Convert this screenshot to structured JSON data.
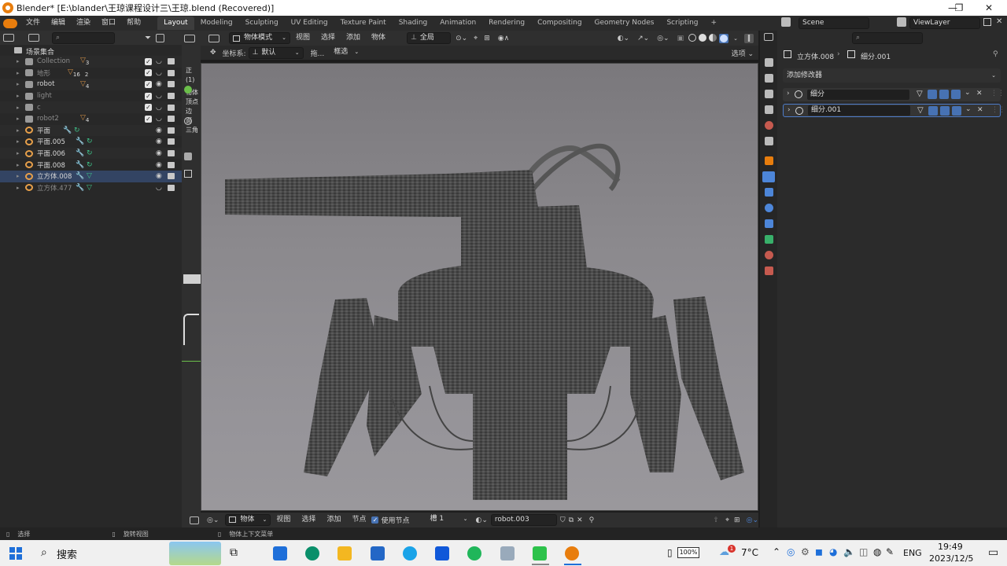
{
  "window": {
    "title": "Blender* [E:\\blander\\王琼课程设计三\\王琼.blend (Recovered)]",
    "minimize": "—",
    "maximize": "❐",
    "close": "✕"
  },
  "topbar": {
    "menus": [
      "文件",
      "编辑",
      "渲染",
      "窗口",
      "帮助"
    ],
    "workspaces": [
      "Layout",
      "Modeling",
      "Sculpting",
      "UV Editing",
      "Texture Paint",
      "Shading",
      "Animation",
      "Rendering",
      "Compositing",
      "Geometry Nodes",
      "Scripting"
    ],
    "active_workspace": "Layout",
    "add_tab": "+",
    "scene_label": "Scene",
    "viewlayer_label": "ViewLayer"
  },
  "outliner": {
    "root_label": "场景集合",
    "rows": [
      {
        "label": "Collection",
        "dim": true,
        "count": "3",
        "checked": true
      },
      {
        "label": "地形",
        "dim": true,
        "count": "16",
        "count2": "2",
        "checked": true
      },
      {
        "label": "robot",
        "dim": false,
        "count": "4",
        "checked": true
      },
      {
        "label": "light",
        "dim": true,
        "checked": true
      },
      {
        "label": "c",
        "dim": true,
        "checked": true
      },
      {
        "label": "robot2",
        "dim": true,
        "count": "4",
        "checked": true
      },
      {
        "label": "平面",
        "dim": false
      },
      {
        "label": "平面.005",
        "dim": false
      },
      {
        "label": "平面.006",
        "dim": false
      },
      {
        "label": "平面.008",
        "dim": false
      },
      {
        "label": "立方体.008",
        "dim": false
      },
      {
        "label": "立方体.477",
        "dim": true
      }
    ]
  },
  "viewport_header": {
    "mode": "物体模式",
    "menus": [
      "视图",
      "选择",
      "添加",
      "物体"
    ],
    "transform": "全局",
    "coord_label": "坐标系:",
    "coord_value": "默认",
    "drag_label": "拖...",
    "select_label": "框选",
    "options_label": "选项"
  },
  "left_overlay_text": [
    "正",
    "(1)",
    "物体",
    "顶点",
    "边",
    "面",
    "三角"
  ],
  "properties": {
    "breadcrumb_object": "立方体.008",
    "breadcrumb_modifier": "细分.001",
    "add_modifier": "添加修改器",
    "modifiers": [
      {
        "name": "细分",
        "selected": false
      },
      {
        "name": "细分.001",
        "selected": true
      }
    ]
  },
  "bottom_header": {
    "mode": "物体",
    "menus": [
      "视图",
      "选择",
      "添加",
      "节点"
    ],
    "use_nodes": "使用节点",
    "slot": "槽 1",
    "material": "robot.003"
  },
  "statusbar": {
    "select": "选择",
    "rotate": "旋转视图",
    "context_menu": "物体上下文菜单"
  },
  "taskbar": {
    "search": "搜索",
    "battery": "100%",
    "weather_badge": "1",
    "temperature": "7°C",
    "language": "ENG",
    "time": "19:49",
    "date": "2023/12/5"
  }
}
